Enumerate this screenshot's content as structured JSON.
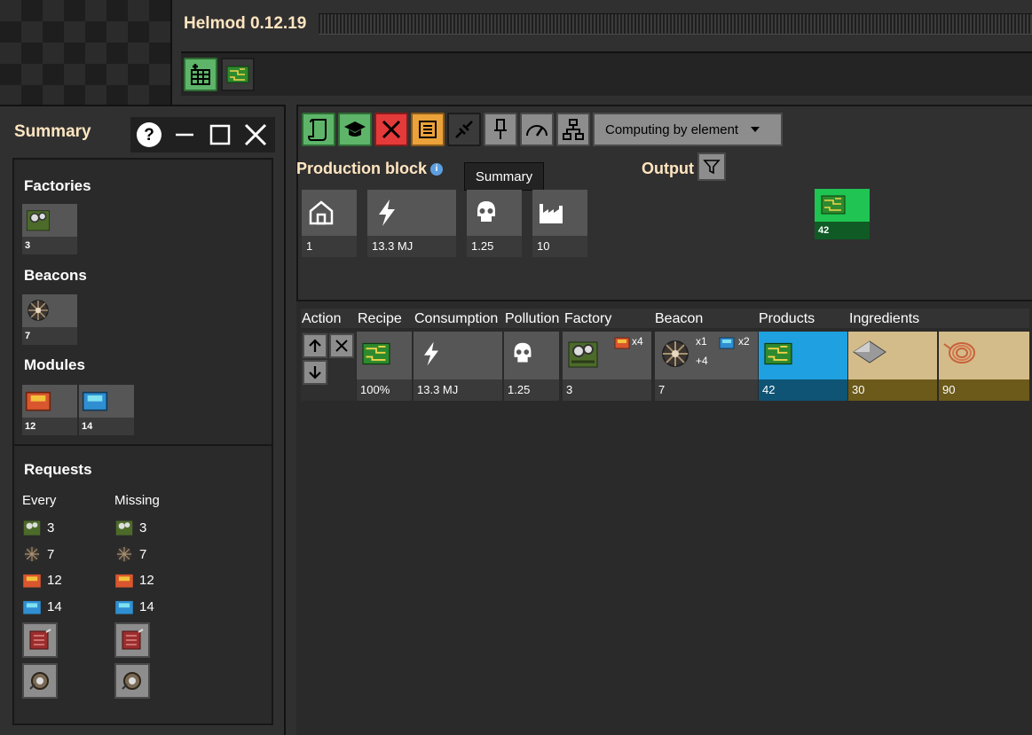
{
  "app_title": "Helmod 0.12.19",
  "toolbar": {
    "dropdown_label": "Computing by element"
  },
  "tooltip": "Summary",
  "production_block": {
    "title": "Production block",
    "stats": [
      "1",
      "13.3 MJ",
      "1.25",
      "10"
    ]
  },
  "output": {
    "title": "Output",
    "value": "42"
  },
  "table": {
    "headers": [
      "Action",
      "Recipe",
      "Consumption",
      "Pollution",
      "Factory",
      "Beacon",
      "Products",
      "Ingredients"
    ],
    "row": {
      "recipe": "100%",
      "consumption": "13.3 MJ",
      "pollution": "1.25",
      "factory": "3",
      "factory_mod": "x4",
      "beacon": "7",
      "beacon_mod1": "x1",
      "beacon_mod2": "x2",
      "beacon_plus": "+4",
      "product": "42",
      "ingredient1": "30",
      "ingredient2": "90"
    }
  },
  "summary": {
    "title": "Summary",
    "factories_title": "Factories",
    "factories_count": "3",
    "beacons_title": "Beacons",
    "beacons_count": "7",
    "modules_title": "Modules",
    "module1": "12",
    "module2": "14",
    "requests_title": "Requests",
    "every": "Every",
    "missing": "Missing",
    "every_values": [
      "3",
      "7",
      "12",
      "14"
    ],
    "missing_values": [
      "3",
      "7",
      "12",
      "14"
    ]
  },
  "colors": {
    "title": "#ffe6c0",
    "green": "#5eb56a",
    "product": "#1fa0e0",
    "ingredient": "#d4bc8a",
    "output": "#1fc452"
  }
}
